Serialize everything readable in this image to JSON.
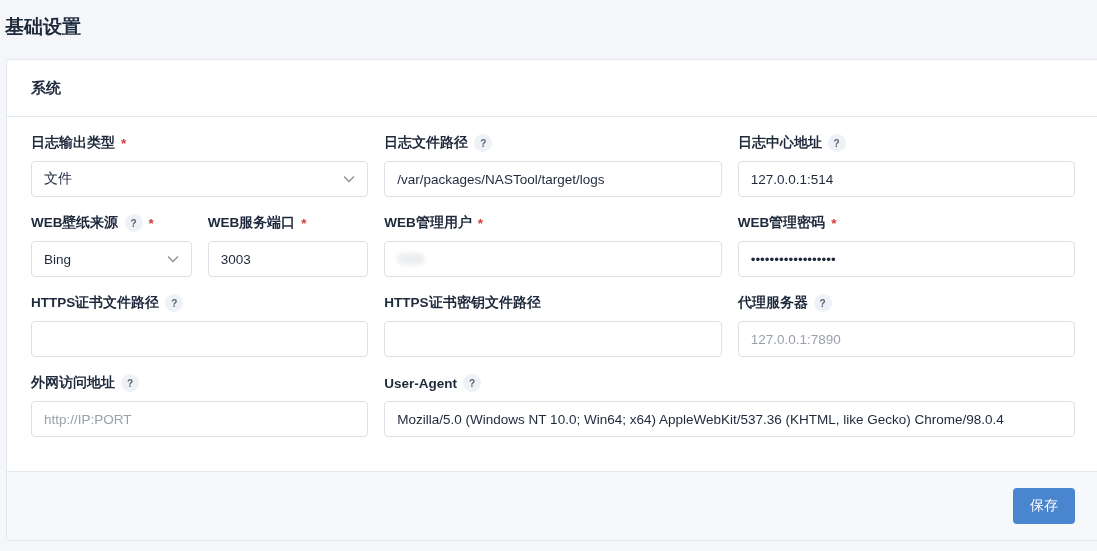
{
  "page_title": "基础设置",
  "card": {
    "title": "系统",
    "rows": [
      [
        [
          {
            "label": "日志输出类型",
            "required_mark": "*",
            "kind": "select",
            "value": "文件"
          }
        ],
        [
          {
            "label": "日志文件路径",
            "help_mark": "?",
            "kind": "text",
            "value": "/var/packages/NASTool/target/logs"
          }
        ],
        [
          {
            "label": "日志中心地址",
            "help_mark": "?",
            "kind": "text",
            "value": "127.0.0.1:514"
          }
        ]
      ],
      [
        [
          {
            "label": "WEB壁纸来源",
            "help_mark": "?",
            "required_mark": "*",
            "kind": "select",
            "value": "Bing"
          },
          {
            "label": "WEB服务端口",
            "required_mark": "*",
            "kind": "text",
            "value": "3003"
          }
        ],
        [
          {
            "label": "WEB管理用户",
            "required_mark": "*",
            "kind": "redacted"
          }
        ],
        [
          {
            "label": "WEB管理密码",
            "required_mark": "*",
            "kind": "password",
            "value": "••••••••••••••••••"
          }
        ]
      ],
      [
        [
          {
            "label": "HTTPS证书文件路径",
            "help_mark": "?",
            "kind": "text"
          }
        ],
        [
          {
            "label": "HTTPS证书密钥文件路径",
            "kind": "text"
          }
        ],
        [
          {
            "label": "代理服务器",
            "help_mark": "?",
            "kind": "text",
            "placeholder": "127.0.0.1:7890"
          }
        ]
      ],
      [
        [
          {
            "label": "外网访问地址",
            "help_mark": "?",
            "kind": "text",
            "placeholder": "http://IP:PORT"
          }
        ],
        [
          {
            "label": "User-Agent",
            "help_mark": "?",
            "kind": "text",
            "value": "Mozilla/5.0 (Windows NT 10.0; Win64; x64) AppleWebKit/537.36 (KHTML, like Gecko) Chrome/98.0.4"
          }
        ]
      ]
    ],
    "save_button": "保存"
  }
}
